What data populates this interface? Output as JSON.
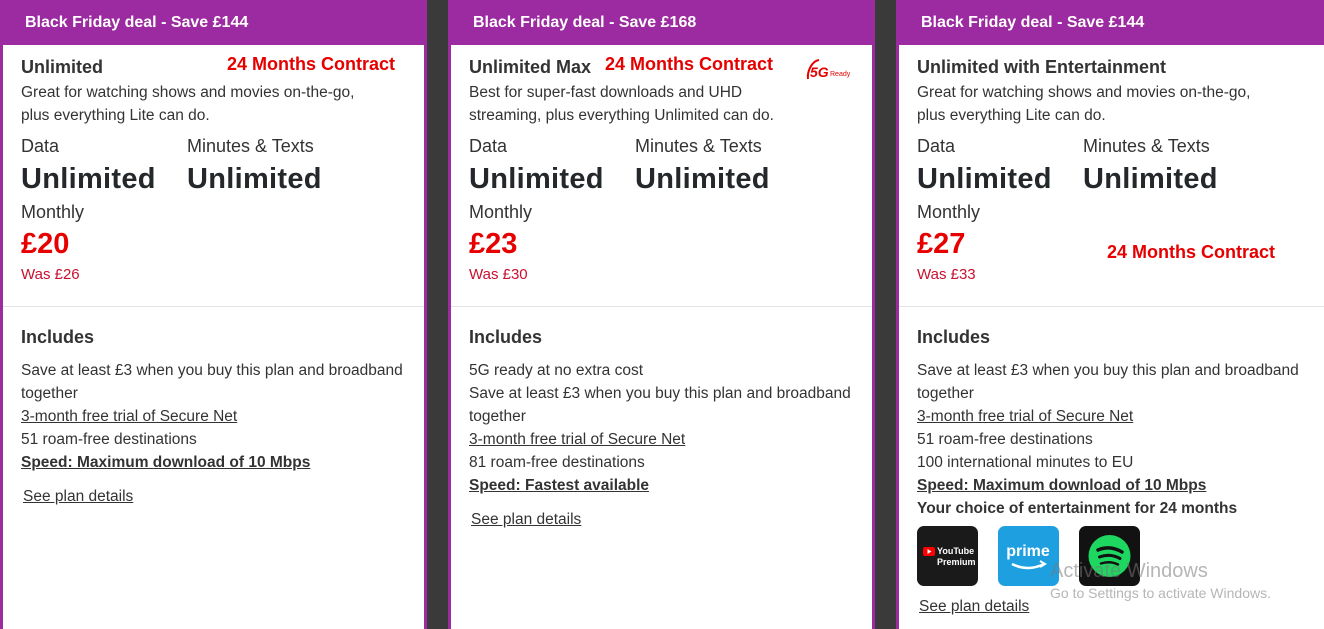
{
  "plans": [
    {
      "banner": "Black Friday deal - Save £144",
      "name": "Unlimited",
      "contract": "24 Months Contract",
      "desc1": "Great for watching shows and movies on-the-go,",
      "desc2": "plus everything Lite can do.",
      "data_label": "Data",
      "data_value": "Unlimited",
      "mins_label": "Minutes & Texts",
      "mins_value": "Unlimited",
      "monthly_label": "Monthly",
      "price": "£20",
      "was": "Was £26",
      "includes_title": "Includes",
      "inc1": "Save at least £3 when you buy this plan and broadband together",
      "inc2": "3-month free trial of Secure Net",
      "inc3": "51 roam-free destinations",
      "speed": "Speed: Maximum download of 10 Mbps",
      "see": "See plan details"
    },
    {
      "banner": "Black Friday deal - Save £168",
      "name": "Unlimited Max",
      "contract": "24 Months Contract",
      "badge_big": "5G",
      "badge_small": "Ready",
      "desc1": "Best for super-fast downloads and UHD",
      "desc2": "streaming, plus everything Unlimited can do.",
      "data_label": "Data",
      "data_value": "Unlimited",
      "mins_label": "Minutes & Texts",
      "mins_value": "Unlimited",
      "monthly_label": "Monthly",
      "price": "£23",
      "was": "Was £30",
      "includes_title": "Includes",
      "inc0": "5G ready at no extra cost",
      "inc1": "Save at least £3 when you buy this plan and broadband together",
      "inc2": "3-month free trial of Secure Net",
      "inc3": "81 roam-free destinations",
      "speed": "Speed: Fastest available",
      "see": "See plan details"
    },
    {
      "banner": "Black Friday deal - Save £144",
      "name": "Unlimited with Entertainment",
      "contract": "24 Months Contract",
      "desc1": "Great for watching shows and movies on-the-go,",
      "desc2": "plus everything Lite can do.",
      "data_label": "Data",
      "data_value": "Unlimited",
      "mins_label": "Minutes & Texts",
      "mins_value": "Unlimited",
      "monthly_label": "Monthly",
      "price": "£27",
      "was": "Was £33",
      "includes_title": "Includes",
      "inc1": "Save at least £3 when you buy this plan and broadband together",
      "inc2": "3-month free trial of Secure Net",
      "inc3": "51 roam-free destinations",
      "inc4": "100 international minutes to EU",
      "speed": "Speed: Maximum download of 10 Mbps",
      "choice": "Your choice of entertainment for 24 months",
      "yt_line1": "YouTube",
      "yt_line2": "Premium",
      "prime_label": "prime",
      "see": "See plan details"
    }
  ],
  "watermark": {
    "line1": "Activate Windows",
    "line2": "Go to Settings to activate Windows."
  },
  "colors": {
    "brand_purple": "#9c2aa0",
    "price_red": "#e60000"
  }
}
